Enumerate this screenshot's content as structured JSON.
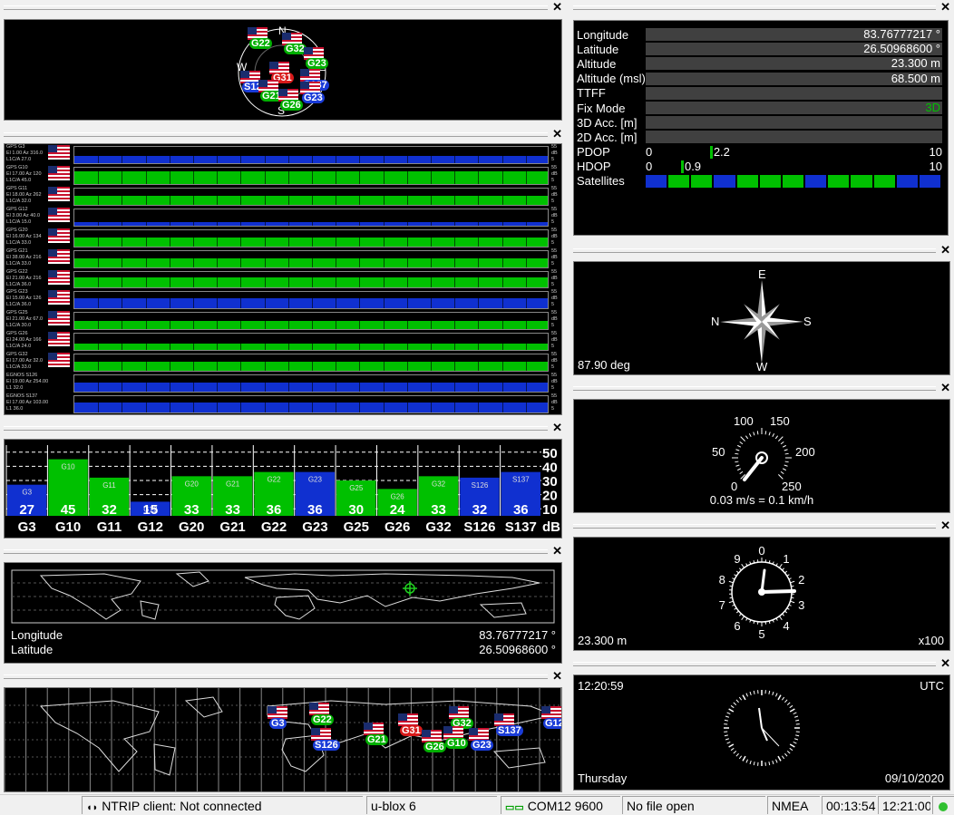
{
  "sky": {
    "compass": {
      "n": "N",
      "e": "E",
      "s": "S",
      "w": "W"
    },
    "sats": [
      {
        "label": "G22",
        "color": "green"
      },
      {
        "label": "G32",
        "color": "green"
      },
      {
        "label": "G23",
        "color": "green"
      },
      {
        "label": "G31",
        "color": "red"
      },
      {
        "label": "S137",
        "color": "blue"
      },
      {
        "label": "S126",
        "color": "blue"
      },
      {
        "label": "G21",
        "color": "green"
      },
      {
        "label": "G26",
        "color": "green"
      },
      {
        "label": "G23",
        "color": "blue"
      }
    ]
  },
  "signal_history": {
    "rows": [
      {
        "lines": [
          "GPS G3",
          "El 1.00 Az 316.0",
          "L1C/A 27.0"
        ],
        "color": "blue",
        "unit": [
          "55",
          "dB",
          "5"
        ]
      },
      {
        "lines": [
          "GPS G10",
          "El 17.00 Az 120",
          "L1C/A 45.0"
        ],
        "color": "green",
        "unit": [
          "55",
          "dB",
          "5"
        ]
      },
      {
        "lines": [
          "GPS G11",
          "El 18.00 Az 262",
          "L1C/A 32.0"
        ],
        "color": "green",
        "unit": [
          "55",
          "dB",
          "5"
        ]
      },
      {
        "lines": [
          "GPS G12",
          "El 3.00 Az 40.0",
          "L1C/A 15.0"
        ],
        "color": "blue",
        "unit": [
          "55",
          "dB",
          "5"
        ]
      },
      {
        "lines": [
          "GPS G20",
          "El 16.00 Az 134",
          "L1C/A 33.0"
        ],
        "color": "green",
        "unit": [
          "55",
          "dB",
          "5"
        ]
      },
      {
        "lines": [
          "GPS G21",
          "El 38.00 Az 216",
          "L1C/A 33.0"
        ],
        "color": "green",
        "unit": [
          "55",
          "dB",
          "5"
        ]
      },
      {
        "lines": [
          "GPS G22",
          "El 21.00 Az 216",
          "L1C/A 36.0"
        ],
        "color": "green",
        "unit": [
          "55",
          "dB",
          "5"
        ]
      },
      {
        "lines": [
          "GPS G23",
          "El 15.00 Az 126",
          "L1C/A 36.0"
        ],
        "color": "blue",
        "unit": [
          "55",
          "dB",
          "5"
        ]
      },
      {
        "lines": [
          "GPS G25",
          "El 21.00 Az 67.0",
          "L1C/A 30.0"
        ],
        "color": "green",
        "unit": [
          "55",
          "dB",
          "5"
        ]
      },
      {
        "lines": [
          "GPS G26",
          "El 24.00 Az 166",
          "L1C/A 24.0"
        ],
        "color": "green",
        "unit": [
          "55",
          "dB",
          "5"
        ]
      },
      {
        "lines": [
          "GPS G32",
          "El 17.00 Az 32.0",
          "L1C/A 33.0"
        ],
        "color": "green",
        "unit": [
          "55",
          "dB",
          "5"
        ]
      },
      {
        "lines": [
          "EGNOS S126",
          "El 19.00 Az 254.00",
          "L1 32.0"
        ],
        "color": "blue",
        "unit": [
          "55",
          "dB",
          "5"
        ]
      },
      {
        "lines": [
          "EGNOS S137",
          "El 17.00 Az 103.00",
          "L1 36.0"
        ],
        "color": "blue",
        "unit": [
          "55",
          "dB",
          "5"
        ]
      }
    ]
  },
  "chart_data": {
    "type": "bar",
    "categories": [
      "G3",
      "G10",
      "G11",
      "G12",
      "G20",
      "G21",
      "G22",
      "G23",
      "G25",
      "G26",
      "G32",
      "S126",
      "S137"
    ],
    "values": [
      27,
      45,
      32,
      15,
      33,
      33,
      36,
      36,
      30,
      24,
      33,
      32,
      36
    ],
    "bar_colors": [
      "blue",
      "green",
      "green",
      "blue",
      "green",
      "green",
      "green",
      "blue",
      "green",
      "green",
      "green",
      "blue",
      "blue"
    ],
    "ylim": [
      5,
      55
    ],
    "yticks": [
      "50",
      "40",
      "30",
      "20",
      "10"
    ],
    "unit": "dB"
  },
  "world": {
    "lon_label": "Longitude",
    "lat_label": "Latitude",
    "lon_value": "83.76777217 °",
    "lat_value": "26.50968600 °"
  },
  "satmap": {
    "sats": [
      {
        "label": "G3",
        "color": "blue"
      },
      {
        "label": "G22",
        "color": "green"
      },
      {
        "label": "S126",
        "color": "blue"
      },
      {
        "label": "G21",
        "color": "green"
      },
      {
        "label": "G31",
        "color": "red"
      },
      {
        "label": "G26",
        "color": "green"
      },
      {
        "label": "G32",
        "color": "green"
      },
      {
        "label": "G10",
        "color": "green"
      },
      {
        "label": "G23",
        "color": "blue"
      },
      {
        "label": "S137",
        "color": "blue"
      },
      {
        "label": "G12",
        "color": "blue"
      }
    ]
  },
  "nav": {
    "rows": [
      {
        "label": "Longitude",
        "value": "83.76777217 °"
      },
      {
        "label": "Latitude",
        "value": "26.50968600 °"
      },
      {
        "label": "Altitude",
        "value": "23.300 m"
      },
      {
        "label": "Altitude (msl)",
        "value": "68.500 m"
      },
      {
        "label": "TTFF",
        "value": ""
      },
      {
        "label": "Fix Mode",
        "value": "3D"
      },
      {
        "label": "3D Acc. [m]",
        "value": ""
      },
      {
        "label": "2D Acc. [m]",
        "value": ""
      }
    ],
    "pdop": {
      "label": "PDOP",
      "min": "0",
      "max": "10",
      "value": "2.2",
      "level": 0.22
    },
    "hdop": {
      "label": "HDOP",
      "min": "0",
      "max": "10",
      "value": "0.9",
      "level": 0.09
    },
    "satellites_label": "Satellites",
    "sat_blocks": [
      "blue",
      "green",
      "green",
      "blue",
      "green",
      "green",
      "green",
      "blue",
      "green",
      "green",
      "green",
      "blue",
      "blue"
    ],
    "fix_color": "#00c000"
  },
  "compass": {
    "n": "N",
    "e": "E",
    "s": "S",
    "w": "W",
    "heading": "87.90 deg"
  },
  "speed": {
    "ticks": [
      "100",
      "150",
      "50",
      "200",
      "0",
      "250"
    ],
    "value": "0.03 m/s = 0.1 km/h"
  },
  "altimeter": {
    "ticks": [
      "0",
      "1",
      "2",
      "3",
      "4",
      "5",
      "6",
      "7",
      "8",
      "9"
    ],
    "value": "23.300 m",
    "mult": "x100"
  },
  "clock": {
    "time": "12:20:59",
    "zone": "UTC",
    "day": "Thursday",
    "date": "09/10/2020"
  },
  "statusbar": {
    "ntrip": "NTRIP client: Not connected",
    "receiver": "u-blox 6",
    "port": "COM12 9600",
    "file": "No file open",
    "protocol": "NMEA",
    "elapsed": "00:13:54",
    "clock": "12:21:00"
  }
}
